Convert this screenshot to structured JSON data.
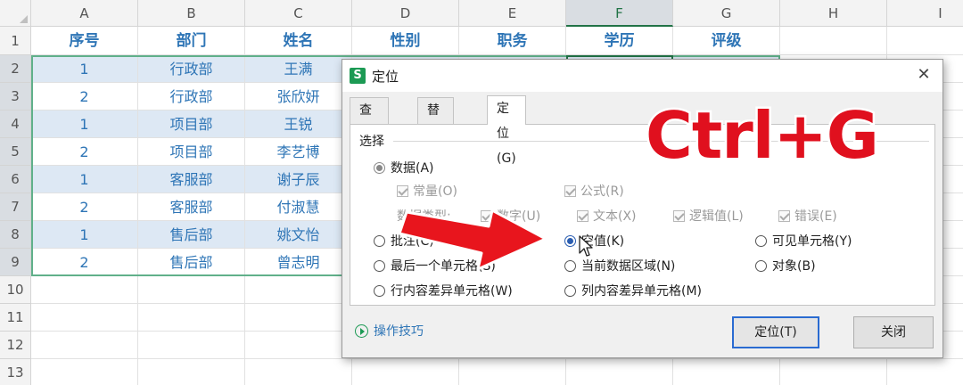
{
  "sheet": {
    "columns": [
      "A",
      "B",
      "C",
      "D",
      "E",
      "F",
      "G",
      "H",
      "I"
    ],
    "rows": [
      "1",
      "2",
      "3",
      "4",
      "5",
      "6",
      "7",
      "8",
      "9",
      "10",
      "11",
      "12",
      "13"
    ],
    "headers": [
      "序号",
      "部门",
      "姓名",
      "性别",
      "职务",
      "学历",
      "评级"
    ],
    "data": [
      [
        "1",
        "行政部",
        "王满"
      ],
      [
        "2",
        "行政部",
        "张欣妍"
      ],
      [
        "1",
        "项目部",
        "王锐"
      ],
      [
        "2",
        "项目部",
        "李艺博"
      ],
      [
        "1",
        "客服部",
        "谢子辰"
      ],
      [
        "2",
        "客服部",
        "付淑慧"
      ],
      [
        "1",
        "售后部",
        "姚文怡"
      ],
      [
        "2",
        "售后部",
        "曾志明"
      ]
    ]
  },
  "dialog": {
    "title": "定位",
    "app_icon_text": "S",
    "close_glyph": "✕",
    "tabs": [
      "查找(D)",
      "替换(P)",
      "定位(G)"
    ],
    "active_tab": 2,
    "group_label": "选择",
    "data_radio": "数据(A)",
    "checks_row1": [
      "常量(O)",
      "公式(R)"
    ],
    "data_type_label": "数据类型:",
    "checks_row2": [
      "数字(U)",
      "文本(X)",
      "逻辑值(L)",
      "错误(E)"
    ],
    "options": {
      "comment": "批注(C)",
      "null_value": "空值(K)",
      "visible_cells": "可见单元格(Y)",
      "last_cell": "最后一个单元格(S)",
      "current_region": "当前数据区域(N)",
      "objects": "对象(B)",
      "row_diff": "行内容差异单元格(W)",
      "col_diff": "列内容差异单元格(M)"
    },
    "selected_option": "null_value",
    "tips_label": "操作技巧",
    "locate_button": "定位(T)",
    "close_button": "关闭"
  },
  "overlay": {
    "shortcut_text": "Ctrl+G",
    "shortcut_color": "#e0101e"
  },
  "colors": {
    "header_text": "#2e75b6",
    "band_fill": "#dde8f4",
    "accent_green": "#217346",
    "selected_radio": "#2a5db0"
  }
}
